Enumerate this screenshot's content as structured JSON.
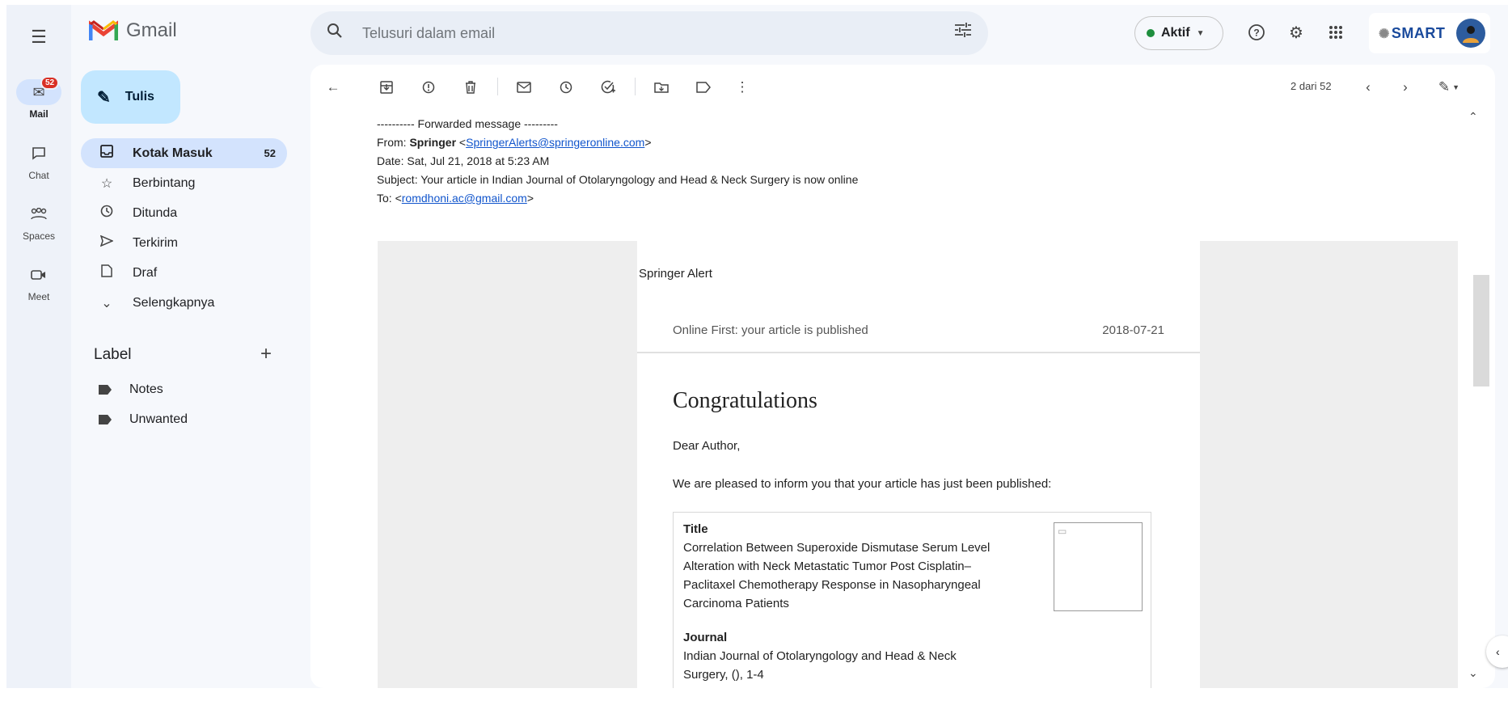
{
  "app": {
    "name": "Gmail"
  },
  "rail": {
    "items": [
      {
        "label": "Mail",
        "icon": "mail-icon",
        "badge": "52"
      },
      {
        "label": "Chat",
        "icon": "chat-icon"
      },
      {
        "label": "Spaces",
        "icon": "spaces-icon"
      },
      {
        "label": "Meet",
        "icon": "meet-icon"
      }
    ]
  },
  "search": {
    "placeholder": "Telusuri dalam email"
  },
  "status": {
    "label": "Aktif"
  },
  "compose": {
    "label": "Tulis"
  },
  "nav": [
    {
      "label": "Kotak Masuk",
      "count": "52"
    },
    {
      "label": "Berbintang"
    },
    {
      "label": "Ditunda"
    },
    {
      "label": "Terkirim"
    },
    {
      "label": "Draf"
    },
    {
      "label": "Selengkapnya"
    }
  ],
  "labels": {
    "heading": "Label",
    "items": [
      "Notes",
      "Unwanted"
    ]
  },
  "pager": {
    "text": "2 dari 52"
  },
  "forward": {
    "separator": "---------- Forwarded message ---------",
    "from_prefix": "From: ",
    "from_name": "Springer",
    "from_email": "SpringerAlerts@springeronline.com",
    "date": "Date: Sat, Jul 21, 2018 at 5:23 AM",
    "subject": "Subject: Your article in Indian Journal of Otolaryngology and Head & Neck Surgery is now online",
    "to_prefix": "To: ",
    "to_email": "romdhoni.ac@gmail.com"
  },
  "email": {
    "alert_title": "Springer Alert",
    "online_first": "Online First: your article is published",
    "date": "2018-07-21",
    "heading": "Congratulations",
    "greeting": "Dear Author,",
    "intro": "We are pleased to inform you that your article has just been published:",
    "title_label": "Title",
    "title_text": "Correlation Between Superoxide Dismutase Serum Level Alteration with Neck Metastatic Tumor Post Cisplatin–Paclitaxel Chemotherapy Response in Nasopharyngeal Carcinoma Patients",
    "journal_label": "Journal",
    "journal_text": "Indian Journal of Otolaryngology and Head & Neck Surgery, (), 1-4"
  },
  "account": {
    "org_logo_text": "SMART"
  },
  "colors": {
    "accent": "#0b57d0",
    "compose_bg": "#c2e7ff",
    "active_nav": "#d3e3fd",
    "badge": "#d93025",
    "status_dot": "#1e8e3e"
  }
}
